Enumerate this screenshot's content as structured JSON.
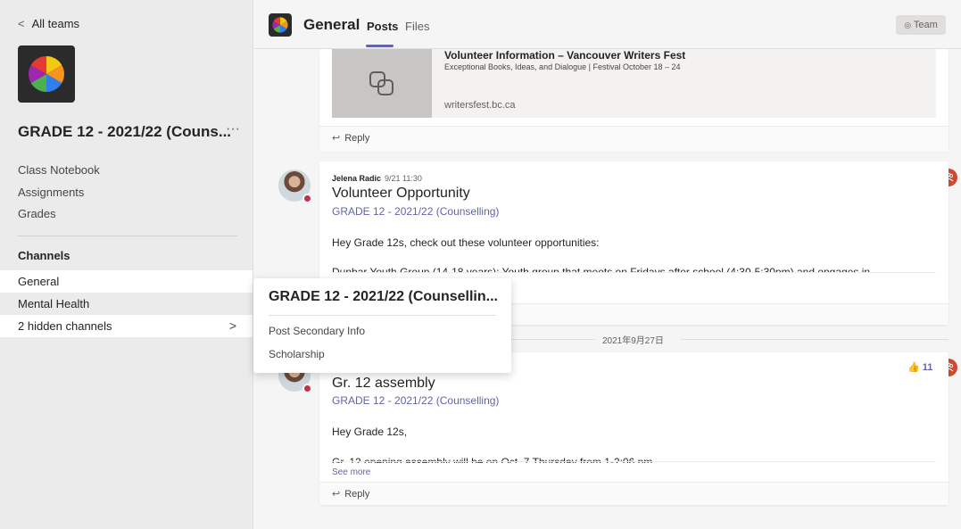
{
  "sidebar": {
    "back_label": "All teams",
    "team_name": "GRADE 12 - 2021/22 (Couns...",
    "more": "···",
    "links": [
      "Class Notebook",
      "Assignments",
      "Grades"
    ],
    "channels_heading": "Channels",
    "channels": [
      "General",
      "Mental Health"
    ],
    "hidden_channels": "2 hidden channels"
  },
  "header": {
    "title": "General",
    "tabs": [
      "Posts",
      "Files"
    ],
    "team_button": "Team"
  },
  "posts": [
    {
      "link_preview": {
        "title": "Volunteer Information – Vancouver Writers Fest",
        "description": "Exceptional Books, Ideas, and Dialogue | Festival October 18 – 24",
        "url": "writersfest.bc.ca"
      },
      "reply_label": "Reply"
    },
    {
      "author": "Jelena Radic",
      "time": "9/21 11:30",
      "title": "Volunteer Opportunity",
      "subtitle": "GRADE 12 - 2021/22 (Counselling)",
      "body": "Hey Grade 12s, check out these volunteer opportunities:",
      "cut_body": "Dunbar Youth Group (14-18 years): Youth group that meets on Fridays after school (4:30-5:30pm) and engages in"
    },
    {
      "title": "Gr. 12 assembly",
      "subtitle": "GRADE 12 - 2021/22 (Counselling)",
      "body": "Hey Grade 12s,",
      "cut_body": "Gr. 12 opening assembly will be on Oct. 7 Thursday from 1-2:06 pm",
      "see_more": "See more",
      "likes": "11",
      "reply_label": "Reply"
    }
  ],
  "date_separator": "2021年9月27日",
  "popup": {
    "title": "GRADE 12 - 2021/22 (Counsellin...",
    "items": [
      "Post Secondary Info",
      "Scholarship"
    ]
  },
  "colors": {
    "accent": "#6264a7",
    "badge": "#cc4a31",
    "status_busy": "#c4314b"
  }
}
